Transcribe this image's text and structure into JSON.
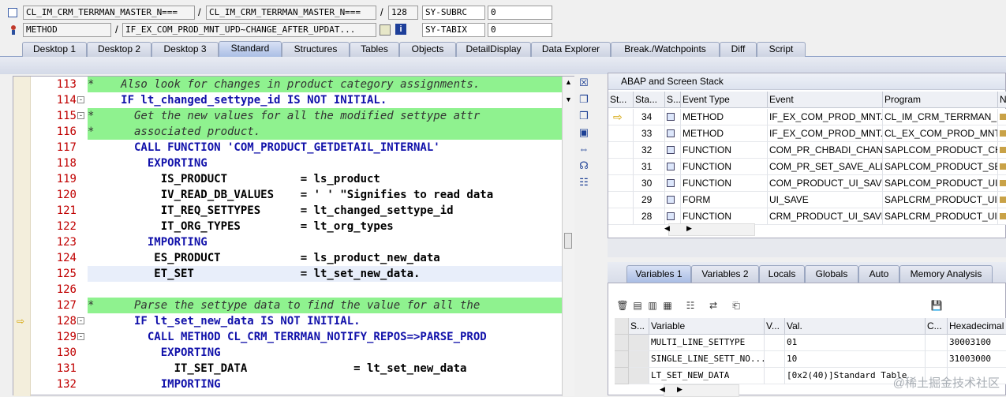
{
  "top": {
    "row1": {
      "icon": "program-icon",
      "field1": "CL_IM_CRM_TERRMAN_MASTER_N===",
      "sep1": "/",
      "field2": "CL_IM_CRM_TERRMAN_MASTER_N===",
      "sep2": "/",
      "line": "128",
      "var_name": "SY-SUBRC",
      "var_value": "0"
    },
    "row2": {
      "icon": "method-icon",
      "field1": "METHOD",
      "sep1": "/",
      "field2": "IF_EX_COM_PROD_MNT_UPD~CHANGE_AFTER_UPDAT...",
      "var_name": "SY-TABIX",
      "var_value": "0"
    }
  },
  "tabs": [
    "Desktop 1",
    "Desktop 2",
    "Desktop 3",
    "Standard",
    "Structures",
    "Tables",
    "Objects",
    "DetailDisplay",
    "Data Explorer",
    "Break./Watchpoints",
    "Diff",
    "Script"
  ],
  "active_tab": "Standard",
  "code": {
    "lines": [
      {
        "n": "113",
        "t": "*    Also look for changes in product category assignments."
      },
      {
        "n": "114",
        "t": "     IF lt_changed_settype_id IS NOT INITIAL."
      },
      {
        "n": "115",
        "t": "*      Get the new values for all the modified settype attr"
      },
      {
        "n": "116",
        "t": "*      associated product."
      },
      {
        "n": "117",
        "t": "       CALL FUNCTION 'COM_PRODUCT_GETDETAIL_INTERNAL'"
      },
      {
        "n": "118",
        "t": "         EXPORTING"
      },
      {
        "n": "119",
        "t": "           IS_PRODUCT           = ls_product"
      },
      {
        "n": "120",
        "t": "           IV_READ_DB_VALUES    = ' ' \"Signifies to read data"
      },
      {
        "n": "121",
        "t": "           IT_REQ_SETTYPES      = lt_changed_settype_id"
      },
      {
        "n": "122",
        "t": "           IT_ORG_TYPES         = lt_org_types"
      },
      {
        "n": "123",
        "t": "         IMPORTING"
      },
      {
        "n": "124",
        "t": "          ES_PRODUCT            = ls_product_new_data"
      },
      {
        "n": "125",
        "t": "          ET_SET                = lt_set_new_data."
      },
      {
        "n": "126",
        "t": ""
      },
      {
        "n": "127",
        "t": "*      Parse the settype data to find the value for all the"
      },
      {
        "n": "128",
        "t": "       IF lt_set_new_data IS NOT INITIAL."
      },
      {
        "n": "129",
        "t": "         CALL METHOD CL_CRM_TERRMAN_NOTIFY_REPOS=>PARSE_PROD"
      },
      {
        "n": "130",
        "t": "           EXPORTING"
      },
      {
        "n": "131",
        "t": "             IT_SET_DATA                = lt_set_new_data"
      },
      {
        "n": "132",
        "t": "           IMPORTING"
      }
    ]
  },
  "stack": {
    "title": "ABAP and Screen Stack",
    "headers": [
      "St...",
      "Sta...",
      "S...",
      "Event Type",
      "Event",
      "Program",
      "Na"
    ],
    "rows": [
      {
        "sta": "34",
        "type": "METHOD",
        "event": "IF_EX_COM_PROD_MNT...",
        "program": "CL_IM_CRM_TERRMAN_..."
      },
      {
        "sta": "33",
        "type": "METHOD",
        "event": "IF_EX_COM_PROD_MNT...",
        "program": "CL_EX_COM_PROD_MNT..."
      },
      {
        "sta": "32",
        "type": "FUNCTION",
        "event": "COM_PR_CHBADI_CHAN...",
        "program": "SAPLCOM_PRODUCT_CH..."
      },
      {
        "sta": "31",
        "type": "FUNCTION",
        "event": "COM_PR_SET_SAVE_ALL",
        "program": "SAPLCOM_PRODUCT_SET"
      },
      {
        "sta": "30",
        "type": "FUNCTION",
        "event": "COM_PRODUCT_UI_SAVE",
        "program": "SAPLCOM_PRODUCT_UI..."
      },
      {
        "sta": "29",
        "type": "FORM",
        "event": "UI_SAVE",
        "program": "SAPLCRM_PRODUCT_UI..."
      },
      {
        "sta": "28",
        "type": "FUNCTION",
        "event": "CRM_PRODUCT_UI_SAVE",
        "program": "SAPLCRM_PRODUCT_UI..."
      }
    ]
  },
  "var_tabs": [
    "Variables 1",
    "Variables 2",
    "Locals",
    "Globals",
    "Auto",
    "Memory Analysis"
  ],
  "vars": {
    "headers": [
      "S...",
      "Variable",
      "V...",
      "Val.",
      "C...",
      "Hexadecimal V"
    ],
    "rows": [
      {
        "name": "MULTI_LINE_SETTYPE",
        "val": "01",
        "hex": "30003100"
      },
      {
        "name": "SINGLE_LINE_SETT_NO...",
        "val": "10",
        "hex": "31003000"
      },
      {
        "name": "LT_SET_NEW_DATA",
        "val": "[0x2(40)]Standard Table",
        "hex": ""
      }
    ]
  },
  "watermark": "@稀土掘金技术社区"
}
